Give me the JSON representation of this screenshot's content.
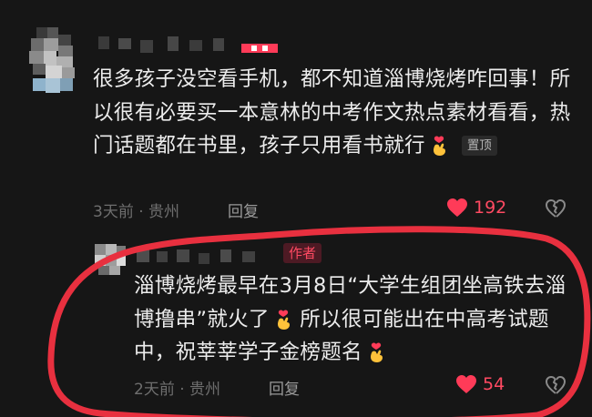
{
  "comments": [
    {
      "text": "很多孩子没空看手机，都不知道淄博烧烤咋回事！所以很有必要买一本意林的中考作文热点素材看看，热门话题都在书里，孩子只用看书就行",
      "emoji": "finger-heart-emoji",
      "pinned_label": "置顶",
      "meta": "3天前 · 贵州",
      "reply_label": "回复",
      "likes": "192"
    },
    {
      "author_badge": "作者",
      "text": "淄博烧烤最早在3月8日“大学生组团坐高铁去淄博撸串”就火了",
      "emoji": "finger-heart-emoji",
      "text_2": "所以很可能出在中高考试题中，祝莘莘学子金榜题名",
      "meta": "2天前 · 贵州",
      "reply_label": "回复",
      "likes": "54"
    }
  ],
  "colors": {
    "background": "#161616",
    "like_red": "#ff4a62",
    "annotation_red": "#e8303f"
  }
}
